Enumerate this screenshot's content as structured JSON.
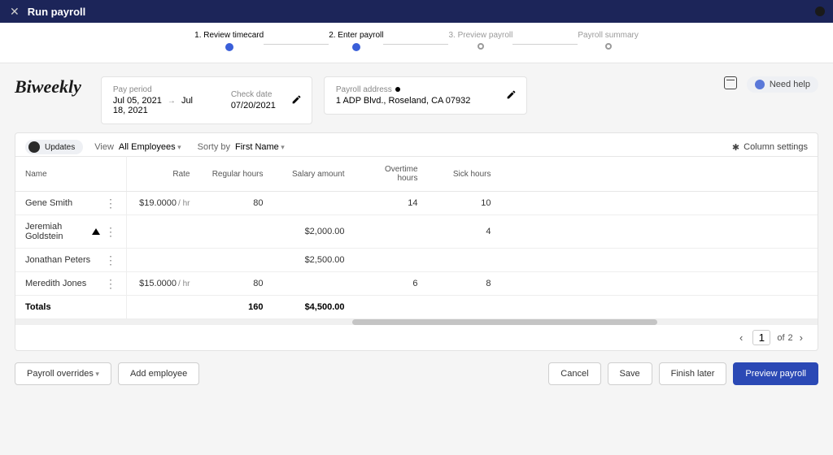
{
  "topbar": {
    "title": "Run payroll"
  },
  "stepper": {
    "s1": "1. Review timecard",
    "s2": "2. Enter payroll",
    "s3": "3. Preview payroll",
    "s4": "Payroll summary"
  },
  "page_title": "Biweekly",
  "pay_period": {
    "label": "Pay period",
    "from": "Jul 05, 2021",
    "to": "Jul 18, 2021"
  },
  "check_date": {
    "label": "Check date",
    "value": "07/20/2021"
  },
  "payroll_address": {
    "label": "Payroll address",
    "value": "1 ADP Blvd., Roseland, CA 07932"
  },
  "need_help": "Need help",
  "toolbar": {
    "updates": "Updates",
    "view_label": "View",
    "view_value": "All Employees",
    "sort_label": "Sorty by",
    "sort_value": "First Name",
    "column_settings": "Column settings"
  },
  "columns": {
    "name": "Name",
    "rate": "Rate",
    "regular": "Regular hours",
    "salary": "Salary amount",
    "overtime": "Overtime hours",
    "sick": "Sick hours"
  },
  "rows": [
    {
      "name": "Gene Smith",
      "rate": "$19.0000",
      "rate_unit": "/ hr",
      "regular": "80",
      "salary": "",
      "overtime": "14",
      "sick": "10",
      "warn": false
    },
    {
      "name": "Jeremiah Goldstein",
      "rate": "",
      "rate_unit": "",
      "regular": "",
      "salary": "$2,000.00",
      "overtime": "",
      "sick": "4",
      "warn": true
    },
    {
      "name": "Jonathan Peters",
      "rate": "",
      "rate_unit": "",
      "regular": "",
      "salary": "$2,500.00",
      "overtime": "",
      "sick": "",
      "warn": false
    },
    {
      "name": "Meredith Jones",
      "rate": "$15.0000",
      "rate_unit": "/ hr",
      "regular": "80",
      "salary": "",
      "overtime": "6",
      "sick": "8",
      "warn": false
    }
  ],
  "totals": {
    "label": "Totals",
    "regular": "160",
    "salary": "$4,500.00"
  },
  "pager": {
    "current": "1",
    "of_label": "of",
    "total": "2"
  },
  "footer": {
    "overrides": "Payroll overrides",
    "add": "Add employee",
    "cancel": "Cancel",
    "save": "Save",
    "finish": "Finish later",
    "preview": "Preview payroll"
  }
}
